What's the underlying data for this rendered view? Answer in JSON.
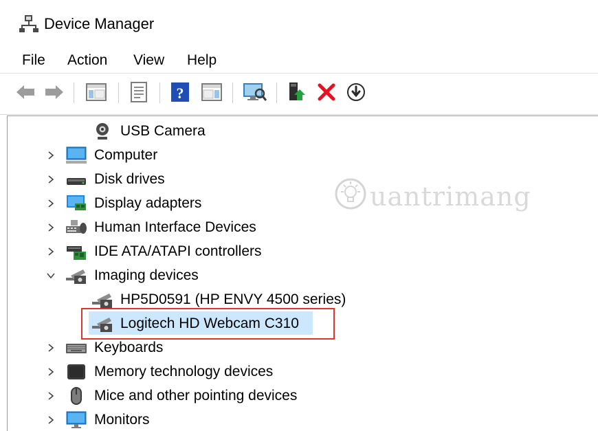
{
  "window": {
    "title": "Device Manager"
  },
  "menu": {
    "items": [
      "File",
      "Action",
      "View",
      "Help"
    ]
  },
  "toolbar": {
    "buttons": [
      {
        "name": "back-arrow-icon"
      },
      {
        "name": "forward-arrow-icon"
      },
      {
        "name": "show-hide-console-tree-icon"
      },
      {
        "name": "properties-icon"
      },
      {
        "name": "help-icon"
      },
      {
        "name": "show-action-pane-icon"
      },
      {
        "name": "scan-hardware-changes-icon"
      },
      {
        "name": "update-driver-icon"
      },
      {
        "name": "uninstall-device-icon"
      },
      {
        "name": "disable-device-icon"
      }
    ]
  },
  "tree": {
    "items": [
      {
        "label": "USB Camera",
        "icon": "webcam-icon",
        "level": 2,
        "expander": "none"
      },
      {
        "label": "Computer",
        "icon": "computer-icon",
        "level": 1,
        "expander": "collapsed"
      },
      {
        "label": "Disk drives",
        "icon": "disk-drive-icon",
        "level": 1,
        "expander": "collapsed"
      },
      {
        "label": "Display adapters",
        "icon": "display-adapter-icon",
        "level": 1,
        "expander": "collapsed"
      },
      {
        "label": "Human Interface Devices",
        "icon": "hid-icon",
        "level": 1,
        "expander": "collapsed"
      },
      {
        "label": "IDE ATA/ATAPI controllers",
        "icon": "ide-controller-icon",
        "level": 1,
        "expander": "collapsed"
      },
      {
        "label": "Imaging devices",
        "icon": "imaging-device-icon",
        "level": 1,
        "expander": "expanded"
      },
      {
        "label": "HP5D0591 (HP ENVY 4500 series)",
        "icon": "imaging-device-icon",
        "level": 2,
        "expander": "none"
      },
      {
        "label": "Logitech HD Webcam C310",
        "icon": "imaging-device-icon",
        "level": 2,
        "expander": "none",
        "selected": true
      },
      {
        "label": "Keyboards",
        "icon": "keyboard-icon",
        "level": 1,
        "expander": "collapsed"
      },
      {
        "label": "Memory technology devices",
        "icon": "memory-device-icon",
        "level": 1,
        "expander": "collapsed"
      },
      {
        "label": "Mice and other pointing devices",
        "icon": "mouse-icon",
        "level": 1,
        "expander": "collapsed"
      },
      {
        "label": "Monitors",
        "icon": "monitor-icon",
        "level": 1,
        "expander": "collapsed"
      }
    ]
  },
  "watermark": {
    "text": "uantrimang"
  },
  "colors": {
    "selection": "#cce8ff",
    "annotation": "#e0322f",
    "delete": "#e81123",
    "help": "#1f4fb6"
  }
}
